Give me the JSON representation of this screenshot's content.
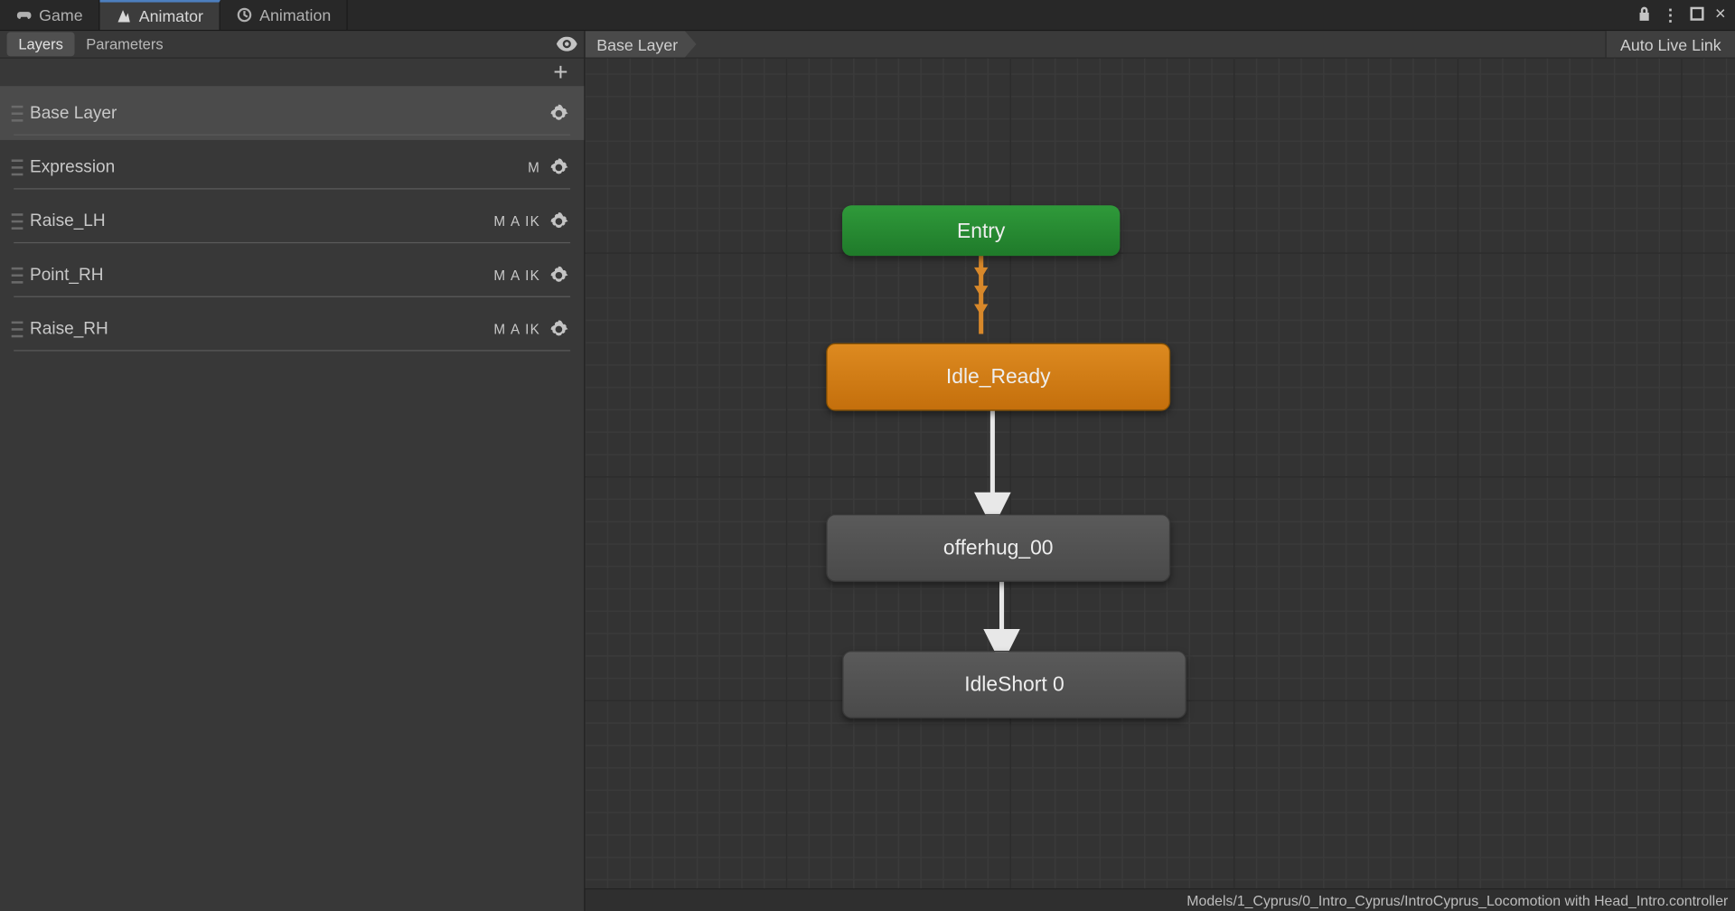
{
  "tabs": {
    "game": "Game",
    "animator": "Animator",
    "animation": "Animation"
  },
  "sidebar": {
    "layers_tab": "Layers",
    "parameters_tab": "Parameters",
    "layers": [
      {
        "name": "Base Layer",
        "badges": ""
      },
      {
        "name": "Expression",
        "badges": "M"
      },
      {
        "name": "Raise_LH",
        "badges": "M A IK"
      },
      {
        "name": "Point_RH",
        "badges": "M A IK"
      },
      {
        "name": "Raise_RH",
        "badges": "M A IK"
      }
    ]
  },
  "graph": {
    "breadcrumb": "Base Layer",
    "auto_live_link": "Auto Live Link",
    "nodes": {
      "entry": "Entry",
      "idle_ready": "Idle_Ready",
      "offerhug": "offerhug_00",
      "idleshort": "IdleShort 0"
    },
    "footer_path": "Models/1_Cyprus/0_Intro_Cyprus/IntroCyprus_Locomotion with Head_Intro.controller"
  }
}
